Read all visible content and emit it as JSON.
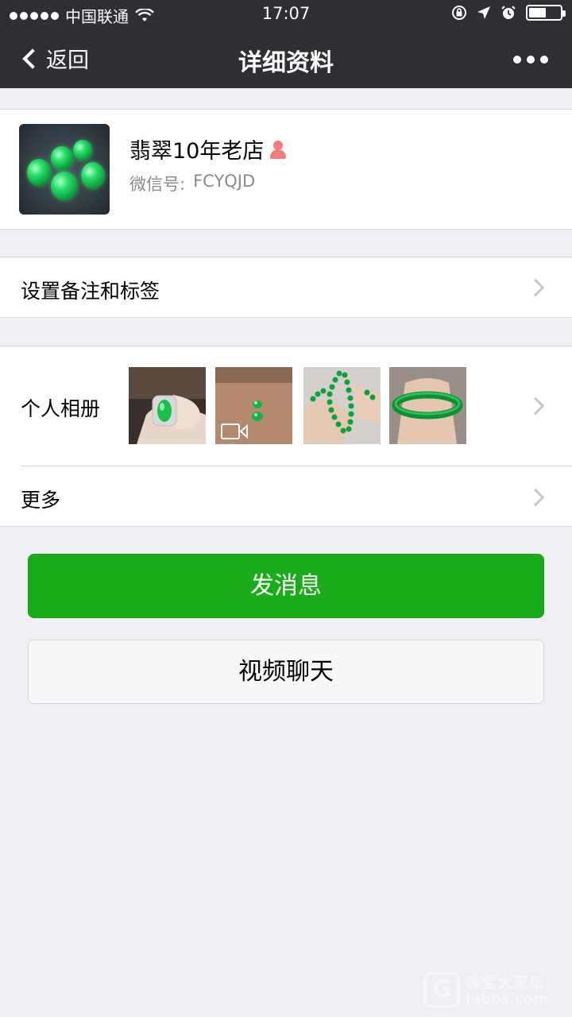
{
  "status_bar": {
    "carrier": "中国联通",
    "time": "17:07",
    "battery_level": 0.55
  },
  "nav": {
    "back_label": "返回",
    "title": "详细资料"
  },
  "profile": {
    "name": "翡翠10年老店",
    "wechat_id_label": "微信号:",
    "wechat_id": "FCYQJD"
  },
  "remark": {
    "label": "设置备注和标签"
  },
  "album": {
    "label": "个人相册"
  },
  "more": {
    "label": "更多"
  },
  "actions": {
    "send_message": "发消息",
    "video_chat": "视频聊天"
  },
  "watermark": {
    "letter": "G",
    "line1": "珠宝大家坛",
    "line2": "Iabbs.com"
  },
  "colors": {
    "nav_bg": "#2e2e33",
    "primary_green": "#1aad19",
    "page_bg": "#efeff4"
  }
}
